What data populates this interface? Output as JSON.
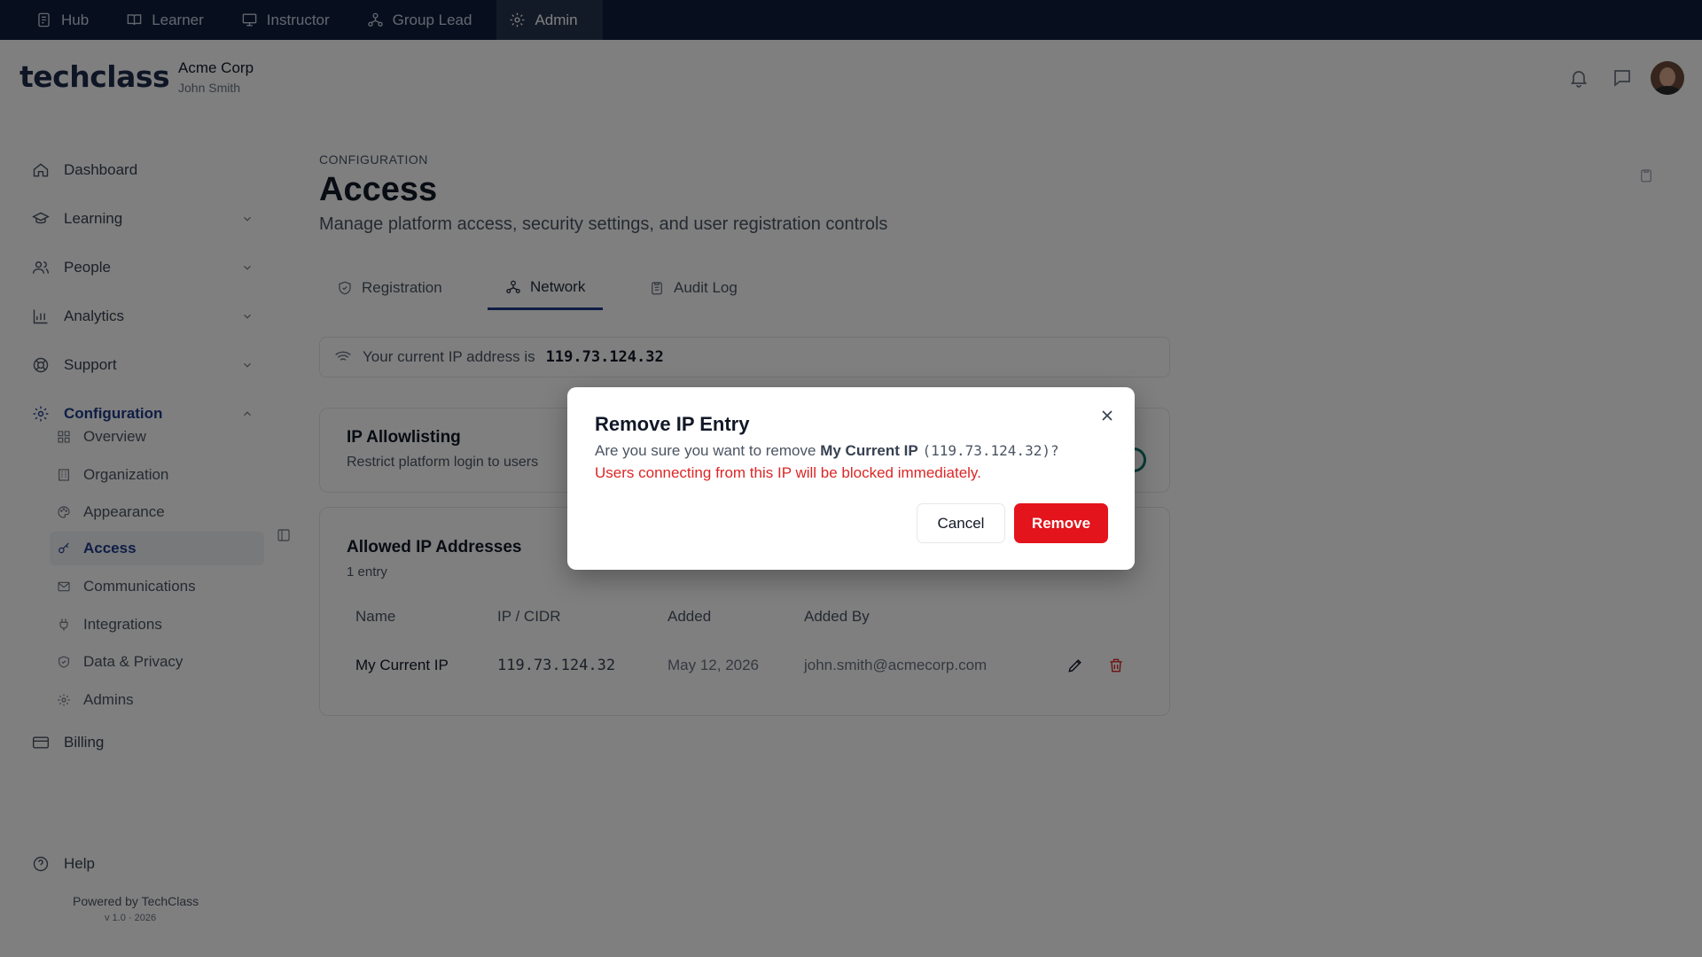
{
  "roles": [
    {
      "label": "Hub",
      "icon": "hub-icon"
    },
    {
      "label": "Learner",
      "icon": "book-icon"
    },
    {
      "label": "Instructor",
      "icon": "monitor-icon"
    },
    {
      "label": "Group Lead",
      "icon": "group-icon"
    },
    {
      "label": "Admin",
      "icon": "gear-icon",
      "active": true
    }
  ],
  "header": {
    "logo_main": "techclass",
    "org_name": "Acme Corp",
    "user_name": "John Smith"
  },
  "sidebar": {
    "items": [
      {
        "label": "Dashboard"
      },
      {
        "label": "Learning"
      },
      {
        "label": "People"
      },
      {
        "label": "Analytics"
      },
      {
        "label": "Support"
      },
      {
        "label": "Configuration",
        "expanded": true
      },
      {
        "label": "Billing"
      }
    ],
    "config_children": [
      {
        "label": "Overview"
      },
      {
        "label": "Organization"
      },
      {
        "label": "Appearance"
      },
      {
        "label": "Access",
        "active": true
      },
      {
        "label": "Communications"
      },
      {
        "label": "Integrations"
      },
      {
        "label": "Data & Privacy"
      },
      {
        "label": "Admins"
      }
    ],
    "help_label": "Help",
    "powered_by": "Powered by TechClass",
    "powered_sub": "v 1.0 · 2026"
  },
  "page": {
    "eyebrow": "CONFIGURATION",
    "title": "Access",
    "description": "Manage platform access, security settings, and user registration controls"
  },
  "tabs": [
    {
      "label": "Registration"
    },
    {
      "label": "Network",
      "active": true
    },
    {
      "label": "Audit Log"
    }
  ],
  "ip_banner": {
    "prefix": "Your current IP address is",
    "ip": "119.73.124.32"
  },
  "allowlisting": {
    "title": "IP Allowlisting",
    "subtitle": "Restrict platform login to users",
    "enabled": true
  },
  "allowed_ips": {
    "title": "Allowed IP Addresses",
    "count_text": "1 entry",
    "columns": [
      "Name",
      "IP / CIDR",
      "Added",
      "Added By"
    ],
    "rows": [
      {
        "name": "My Current IP",
        "ip": "119.73.124.32",
        "added": "May 12, 2026",
        "added_by": "john.smith@acmecorp.com"
      }
    ]
  },
  "modal": {
    "title": "Remove IP Entry",
    "body_prefix": "Are you sure you want to remove",
    "entry_name": "My Current IP",
    "entry_ip_open": "(119.73.124.32)?",
    "warning": "Users connecting from this IP will be blocked immediately.",
    "cancel_label": "Cancel",
    "remove_label": "Remove"
  },
  "colors": {
    "topbar": "#0f1f3d",
    "primary": "#1e3a8a",
    "danger": "#e3141b",
    "toggle_on": "#0f766e"
  }
}
